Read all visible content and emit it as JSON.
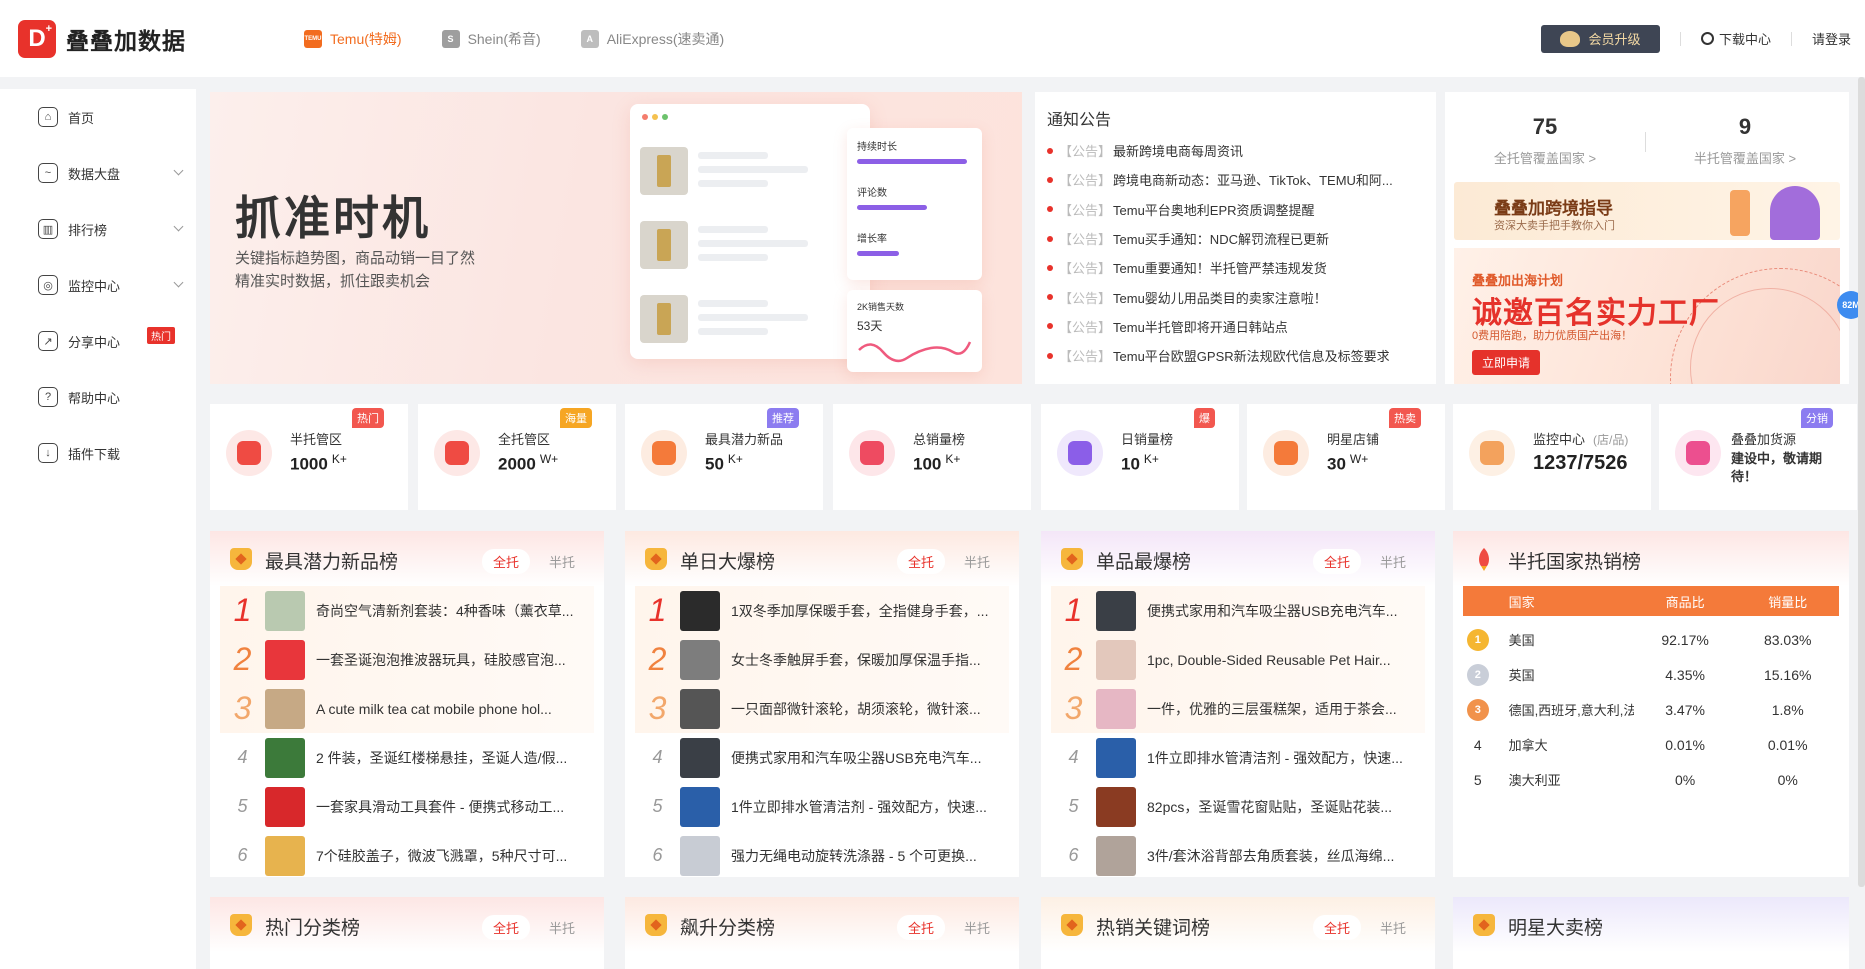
{
  "brand": {
    "name": "叠叠加数据",
    "mark": "D"
  },
  "platforms": [
    {
      "label": "Temu(特姆)",
      "icon_text": "TEMU",
      "active": true
    },
    {
      "label": "Shein(希音)",
      "icon_text": "S",
      "active": false
    },
    {
      "label": "AliExpress(速卖通)",
      "icon_text": "A",
      "active": false
    }
  ],
  "header": {
    "vip_label": "会员升级",
    "download_label": "下载中心",
    "login_label": "请登录"
  },
  "sidebar": {
    "items": [
      {
        "label": "首页",
        "icon": "home-icon"
      },
      {
        "label": "数据大盘",
        "icon": "chart-icon"
      },
      {
        "label": "排行榜",
        "icon": "bar-chart-icon"
      },
      {
        "label": "监控中心",
        "icon": "monitor-icon"
      },
      {
        "label": "分享中心",
        "icon": "share-icon",
        "badge": "热门"
      },
      {
        "label": "帮助中心",
        "icon": "help-icon"
      },
      {
        "label": "插件下载",
        "icon": "download-icon"
      }
    ]
  },
  "banner": {
    "title": "抓准时机",
    "line1": "关键指标趋势图，商品动销一目了然",
    "line2": "精准实时数据，抓住跟卖机会",
    "card_labels": [
      "持续时长",
      "评论数",
      "增长率"
    ],
    "sales_label": "2K销售天数",
    "sales_value": "53天"
  },
  "notice": {
    "title": "通知公告",
    "tag": "【公告】",
    "items": [
      "最新跨境电商每周资讯",
      "跨境电商新动态：亚马逊、TikTok、TEMU和阿...",
      "Temu平台奥地利EPR资质调整提醒",
      "Temu买手通知：NDC解罚流程已更新",
      "Temu重要通知！半托管严禁违规发货",
      "Temu婴幼儿用品类目的卖家注意啦！",
      "Temu半托管即将开通日韩站点",
      "Temu平台欧盟GPSR新法规欧代信息及标签要求"
    ]
  },
  "coverage": {
    "full": {
      "value": "75",
      "label": "全托管覆盖国家 >"
    },
    "half": {
      "value": "9",
      "label": "半托管覆盖国家 >"
    },
    "guide_title": "叠叠加跨境指导",
    "guide_sub": "资深大卖手把手教你入门",
    "ad_line1": "叠叠加出海计划",
    "ad_line2": "诚邀百名实力工厂",
    "ad_line3": "0费用陪跑，助力优质国产出海！",
    "ad_button": "立即申请"
  },
  "float_badge": "82M",
  "stat_cards": [
    {
      "name": "半托管区",
      "value": "1000",
      "unit": "K+",
      "tag": "热门",
      "tag_color": "#f2574f",
      "icon_bg": "#fde8e6",
      "icon_color": "#ef4b43"
    },
    {
      "name": "全托管区",
      "value": "2000",
      "unit": "W+",
      "tag": "海量",
      "tag_color": "#f6a623",
      "icon_bg": "#fde8e6",
      "icon_color": "#ef4b43"
    },
    {
      "name": "最具潜力新品",
      "value": "50",
      "unit": "K+",
      "tag": "推荐",
      "tag_color": "#8c7cf0",
      "icon_bg": "#fdece1",
      "icon_color": "#f47a3a"
    },
    {
      "name": "总销量榜",
      "value": "100",
      "unit": "K+",
      "tag": "",
      "tag_color": "",
      "icon_bg": "#fde6e9",
      "icon_color": "#ee4b61"
    },
    {
      "name": "日销量榜",
      "value": "10",
      "unit": "K+",
      "tag": "爆",
      "tag_color": "#f2574f",
      "icon_bg": "#efe8fc",
      "icon_color": "#8b5ee8"
    },
    {
      "name": "明星店铺",
      "value": "30",
      "unit": "W+",
      "tag": "热卖",
      "tag_color": "#f2574f",
      "icon_bg": "#fdece1",
      "icon_color": "#f47a3a"
    },
    {
      "name": "监控中心",
      "sub": "(店/品)",
      "value": "1237/7526",
      "unit": "",
      "tag": "",
      "tag_color": "",
      "icon_bg": "#fdf0e4",
      "icon_color": "#f3a25d"
    },
    {
      "name": "叠叠加货源",
      "desc": "建设中，敬请期待！",
      "value": "",
      "unit": "",
      "tag": "分销",
      "tag_color": "#8c7cf0",
      "icon_bg": "#fde6f0",
      "icon_color": "#ec4f8f"
    }
  ],
  "rank_panels": [
    {
      "title": "最具潜力新品榜",
      "tabs": [
        "全托",
        "半托"
      ],
      "head_bg": "linear-gradient(180deg,#fde6e4,#fff)",
      "items": [
        "奇尚空气清新剂套装：4种香味（薰衣草...",
        "一套圣诞泡泡推波器玩具，硅胶感官泡...",
        "A cute milk tea cat mobile phone hol...",
        "2 件装，圣诞红楼梯悬挂，圣诞人造/假...",
        "一套家具滑动工具套件 - 便携式移动工...",
        "7个硅胶盖子，微波飞溅罩，5种尺寸可..."
      ],
      "thumbs": [
        "#b9c9b0",
        "#e8363b",
        "#c6a985",
        "#3c7a3a",
        "#d8282b",
        "#e7b34e"
      ]
    },
    {
      "title": "单日大爆榜",
      "tabs": [
        "全托",
        "半托"
      ],
      "head_bg": "linear-gradient(180deg,#fde9e1,#fff)",
      "items": [
        "1双冬季加厚保暖手套，全指健身手套，...",
        "女士冬季触屏手套，保暖加厚保温手指...",
        "一只面部微针滚轮，胡须滚轮，微针滚...",
        "便携式家用和汽车吸尘器USB充电汽车...",
        "1件立即排水管清洁剂 - 强效配方，快速...",
        "强力无绳电动旋转洗涤器 - 5 个可更换..."
      ],
      "thumbs": [
        "#2b2b2b",
        "#7d7d7d",
        "#555555",
        "#3a3f46",
        "#2a5fa9",
        "#c8ccd4"
      ]
    },
    {
      "title": "单品最爆榜",
      "tabs": [
        "全托",
        "半托"
      ],
      "head_bg": "linear-gradient(180deg,#f4e6f8,#fff)",
      "items": [
        "便携式家用和汽车吸尘器USB充电汽车...",
        "1pc, Double-Sided Reusable Pet Hair...",
        "一件，优雅的三层蛋糕架，适用于茶会...",
        "1件立即排水管清洁剂 - 强效配方，快速...",
        "82pcs，圣诞雪花窗贴贴，圣诞贴花装...",
        "3件/套沐浴背部去角质套装，丝瓜海绵..."
      ],
      "thumbs": [
        "#3a3f46",
        "#e3c8bc",
        "#e6b7c4",
        "#2a5fa9",
        "#8a3b22",
        "#b0a39a"
      ]
    }
  ],
  "country_panel": {
    "title": "半托国家热销榜",
    "columns": [
      "国家",
      "商品比",
      "销量比"
    ],
    "rows": [
      {
        "rank": "1",
        "country": "美国",
        "goods": "92.17%",
        "sales": "83.03%",
        "medal": "#f5b631"
      },
      {
        "rank": "2",
        "country": "英国",
        "goods": "4.35%",
        "sales": "15.16%",
        "medal": "#c9ced8"
      },
      {
        "rank": "3",
        "country": "德国,西班牙,意大利,法国",
        "goods": "3.47%",
        "sales": "1.8%",
        "medal": "#f1924b"
      },
      {
        "rank": "4",
        "country": "加拿大",
        "goods": "0.01%",
        "sales": "0.01%",
        "medal": ""
      },
      {
        "rank": "5",
        "country": "澳大利亚",
        "goods": "0%",
        "sales": "0%",
        "medal": ""
      }
    ]
  },
  "bottom_panels": [
    {
      "title": "热门分类榜",
      "tabs": [
        "全托",
        "半托"
      ]
    },
    {
      "title": "飙升分类榜",
      "tabs": [
        "全托",
        "半托"
      ]
    },
    {
      "title": "热销关键词榜",
      "tabs": [
        "全托",
        "半托"
      ]
    },
    {
      "title": "明星大卖榜",
      "tabs": []
    }
  ]
}
